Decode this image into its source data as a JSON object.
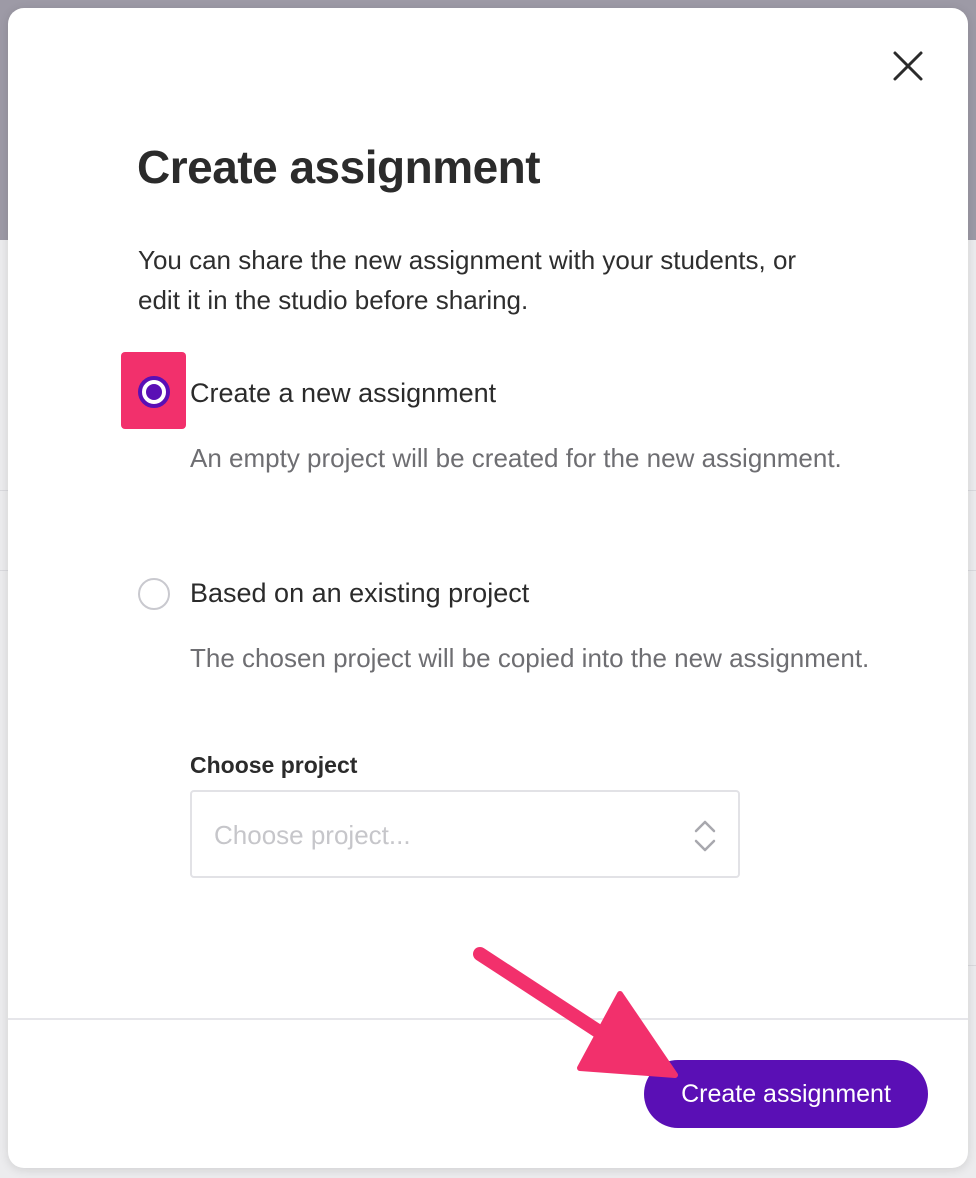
{
  "modal": {
    "title": "Create assignment",
    "intro": "You can share the new assignment with your students, or edit it in the studio before sharing.",
    "options": [
      {
        "label": "Create a new assignment",
        "description": "An empty project will be created for the new assignment.",
        "selected": true
      },
      {
        "label": "Based on an existing project",
        "description": "The chosen project will be copied into the new assignment.",
        "selected": false
      }
    ],
    "choose_project": {
      "label": "Choose project",
      "placeholder": "Choose project..."
    },
    "submit_label": "Create assignment"
  },
  "icons": {
    "close": "close-icon",
    "select": "chevron-up-down-icon"
  },
  "colors": {
    "accent": "#5a0fb5",
    "annotation": "#f2306c",
    "title_text": "#2b2b2b",
    "muted_text": "#6e6e72"
  }
}
